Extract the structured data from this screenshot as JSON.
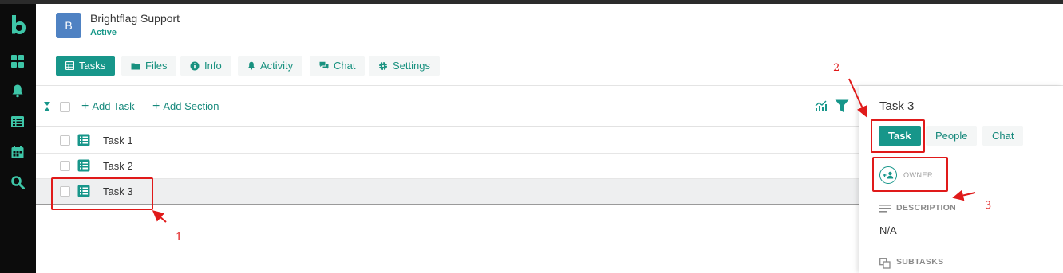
{
  "header": {
    "avatar_letter": "B",
    "name": "Brightflag Support",
    "status": "Active"
  },
  "tabs": [
    {
      "label": "Tasks",
      "icon": "table-icon",
      "active": true
    },
    {
      "label": "Files",
      "icon": "folder-icon"
    },
    {
      "label": "Info",
      "icon": "info-icon"
    },
    {
      "label": "Activity",
      "icon": "bell-icon"
    },
    {
      "label": "Chat",
      "icon": "chat-icon"
    },
    {
      "label": "Settings",
      "icon": "gear-icon"
    }
  ],
  "toolbar": {
    "add_task": "Add Task",
    "add_section": "Add Section"
  },
  "tasks": [
    {
      "name": "Task 1"
    },
    {
      "name": "Task 2"
    },
    {
      "name": "Task 3",
      "selected": true
    }
  ],
  "panel": {
    "title": "Task 3",
    "tabs": [
      {
        "label": "Task",
        "active": true
      },
      {
        "label": "People"
      },
      {
        "label": "Chat"
      }
    ],
    "owner_label": "OWNER",
    "description_label": "DESCRIPTION",
    "description_value": "N/A",
    "subtasks_label": "SUBTASKS"
  },
  "annotations": {
    "label_1": "1",
    "label_2": "2",
    "label_3": "3"
  },
  "colors": {
    "accent": "#17968a",
    "rail": "#0c0c0c",
    "annotation": "#e01a1a",
    "avatar": "#4f82c3"
  }
}
